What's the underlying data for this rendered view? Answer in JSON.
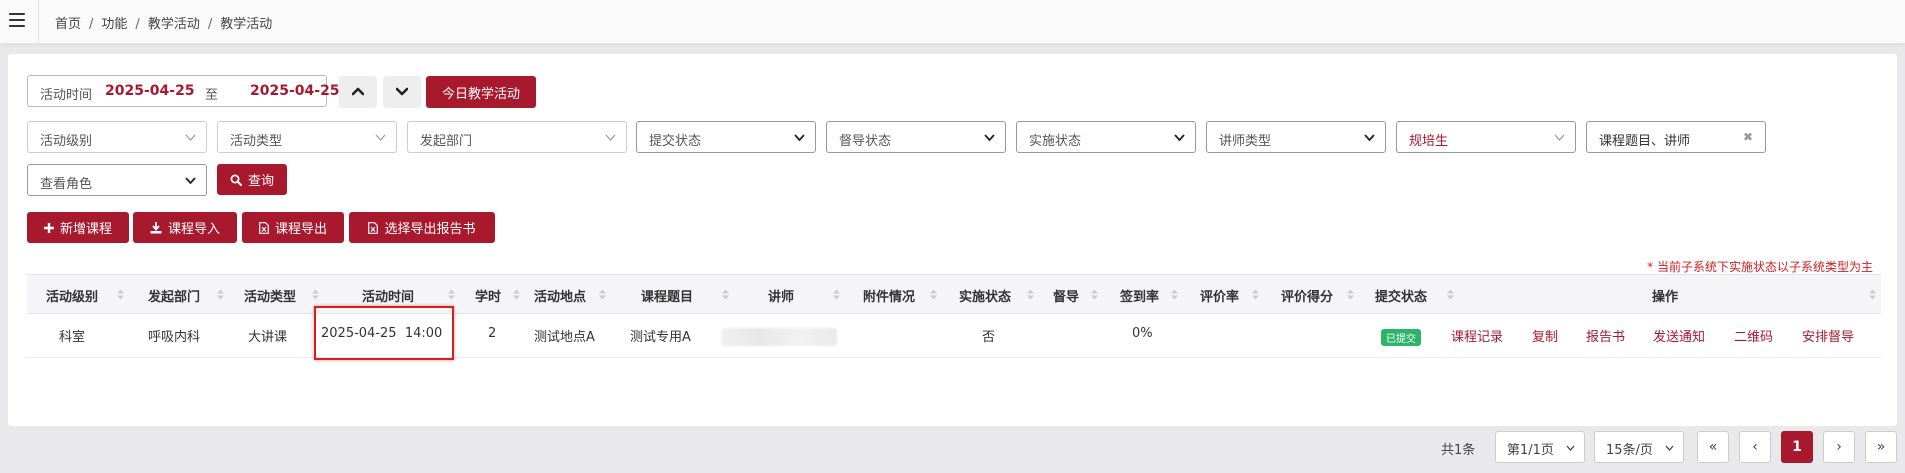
{
  "breadcrumb": [
    "首页",
    "功能",
    "教学活动",
    "教学活动"
  ],
  "filters": {
    "date_label": "活动时间",
    "date_start": "2025-04-25",
    "date_to": "至",
    "date_end": "2025-04-25",
    "today_button": "今日教学活动",
    "level": "活动级别",
    "type": "活动类型",
    "dept": "发起部门",
    "submit_status": "提交状态",
    "supervise_status": "督导状态",
    "impl_status": "实施状态",
    "lecturer_type": "讲师类型",
    "trainee": "规培生",
    "keyword": "课程题目、讲师",
    "view_role": "查看角色",
    "query_button": "查询"
  },
  "toolbar": {
    "add": "新增课程",
    "import": "课程导入",
    "export": "课程导出",
    "export_report": "选择导出报告书"
  },
  "note": "* 当前子系统下实施状态以子系统类型为主",
  "table": {
    "headers": [
      "活动级别",
      "发起部门",
      "活动类型",
      "活动时间",
      "学时",
      "活动地点",
      "课程题目",
      "讲师",
      "附件情况",
      "实施状态",
      "督导",
      "签到率",
      "评价率",
      "评价得分",
      "提交状态",
      "操作"
    ],
    "row": {
      "level": "科室",
      "dept": "呼吸内科",
      "type": "大讲课",
      "time": "2025-04-25  14:00",
      "hours": "2",
      "place": "测试地点A",
      "topic": "测试专用A",
      "impl": "否",
      "signin": "0%",
      "submit": "已提交",
      "actions": [
        "课程记录",
        "复制",
        "报告书",
        "发送通知",
        "二维码",
        "安排督导"
      ]
    }
  },
  "pagination": {
    "total": "共1条",
    "page": "第1/1页",
    "per_page": "15条/页",
    "first": "«",
    "prev": "‹",
    "current": "1",
    "next": "›",
    "last": "»"
  },
  "colors": {
    "accent": "#a8192e",
    "success": "#2db46a",
    "warning": "#d11f1f"
  }
}
